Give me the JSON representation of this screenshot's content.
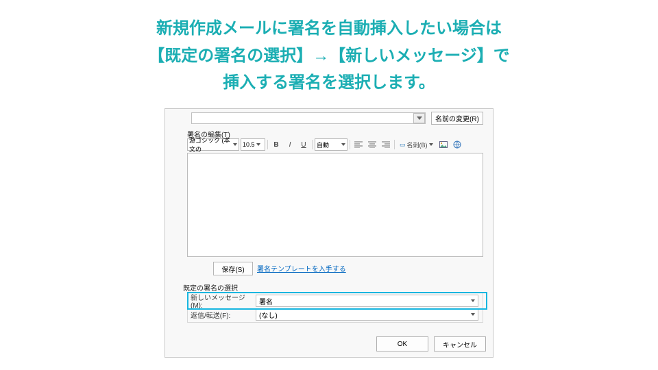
{
  "headline": {
    "line1": "新規作成メールに署名を自動挿入したい場合は",
    "line2": "【既定の署名の選択】→【新しいメッセージ】で",
    "line3": "挿入する署名を選択します。"
  },
  "dialog": {
    "rename_btn": "名前の変更(R)",
    "edit_section": "署名の編集(T)",
    "toolbar": {
      "font": "游ゴシック (本文の",
      "size": "10.5",
      "auto": "自動",
      "card": "名刺(B)"
    },
    "save_btn": "保存(S)",
    "template_link": "署名テンプレートを入手する",
    "select_section": "既定の署名の選択",
    "new_msg_label": "新しいメッセージ(M):",
    "new_msg_value": "署名",
    "reply_label": "返信/転送(F):",
    "reply_value": "(なし)",
    "ok": "OK",
    "cancel": "キャンセル"
  }
}
